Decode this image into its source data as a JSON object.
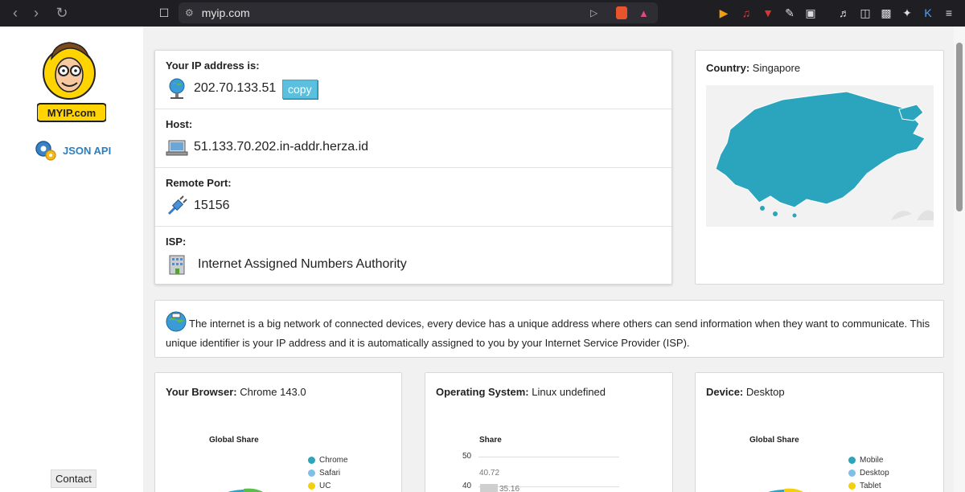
{
  "browser": {
    "url": "myip.com"
  },
  "sidebar": {
    "logo_text": "MYIP.com",
    "json_api_label": "JSON API",
    "contact_label": "Contact"
  },
  "ip_card": {
    "ip_label": "Your IP address is:",
    "ip_value": "202.70.133.51",
    "copy_label": "copy",
    "host_label": "Host:",
    "host_value": "51.133.70.202.in-addr.herza.id",
    "port_label": "Remote Port:",
    "port_value": "15156",
    "isp_label": "ISP:",
    "isp_value": "Internet Assigned Numbers Authority"
  },
  "country_card": {
    "label": "Country:",
    "value": "Singapore"
  },
  "info": {
    "text": "The internet is a big network of connected devices, every device has a unique address where others can send information when they want to communicate. This unique identifier is your IP address and it is automatically assigned to you by your Internet Service Provider (ISP)."
  },
  "browser_card": {
    "label": "Your Browser:",
    "value": "Chrome 143.0",
    "chart_title": "Global Share",
    "legend": [
      "Chrome",
      "Safari",
      "UC"
    ]
  },
  "os_card": {
    "label": "Operating System:",
    "value": "Linux undefined",
    "chart_title": "Share",
    "y_ticks": [
      "50",
      "40"
    ],
    "labels": [
      "40.72",
      "35.16"
    ]
  },
  "device_card": {
    "label": "Device:",
    "value": "Desktop",
    "chart_title": "Global Share",
    "legend": [
      "Mobile",
      "Desktop",
      "Tablet"
    ]
  },
  "colors": {
    "accent": "#2aa5bd",
    "legend_1": "#2aa5bd",
    "legend_2": "#7fbfe8",
    "legend_3": "#f4d00c"
  }
}
